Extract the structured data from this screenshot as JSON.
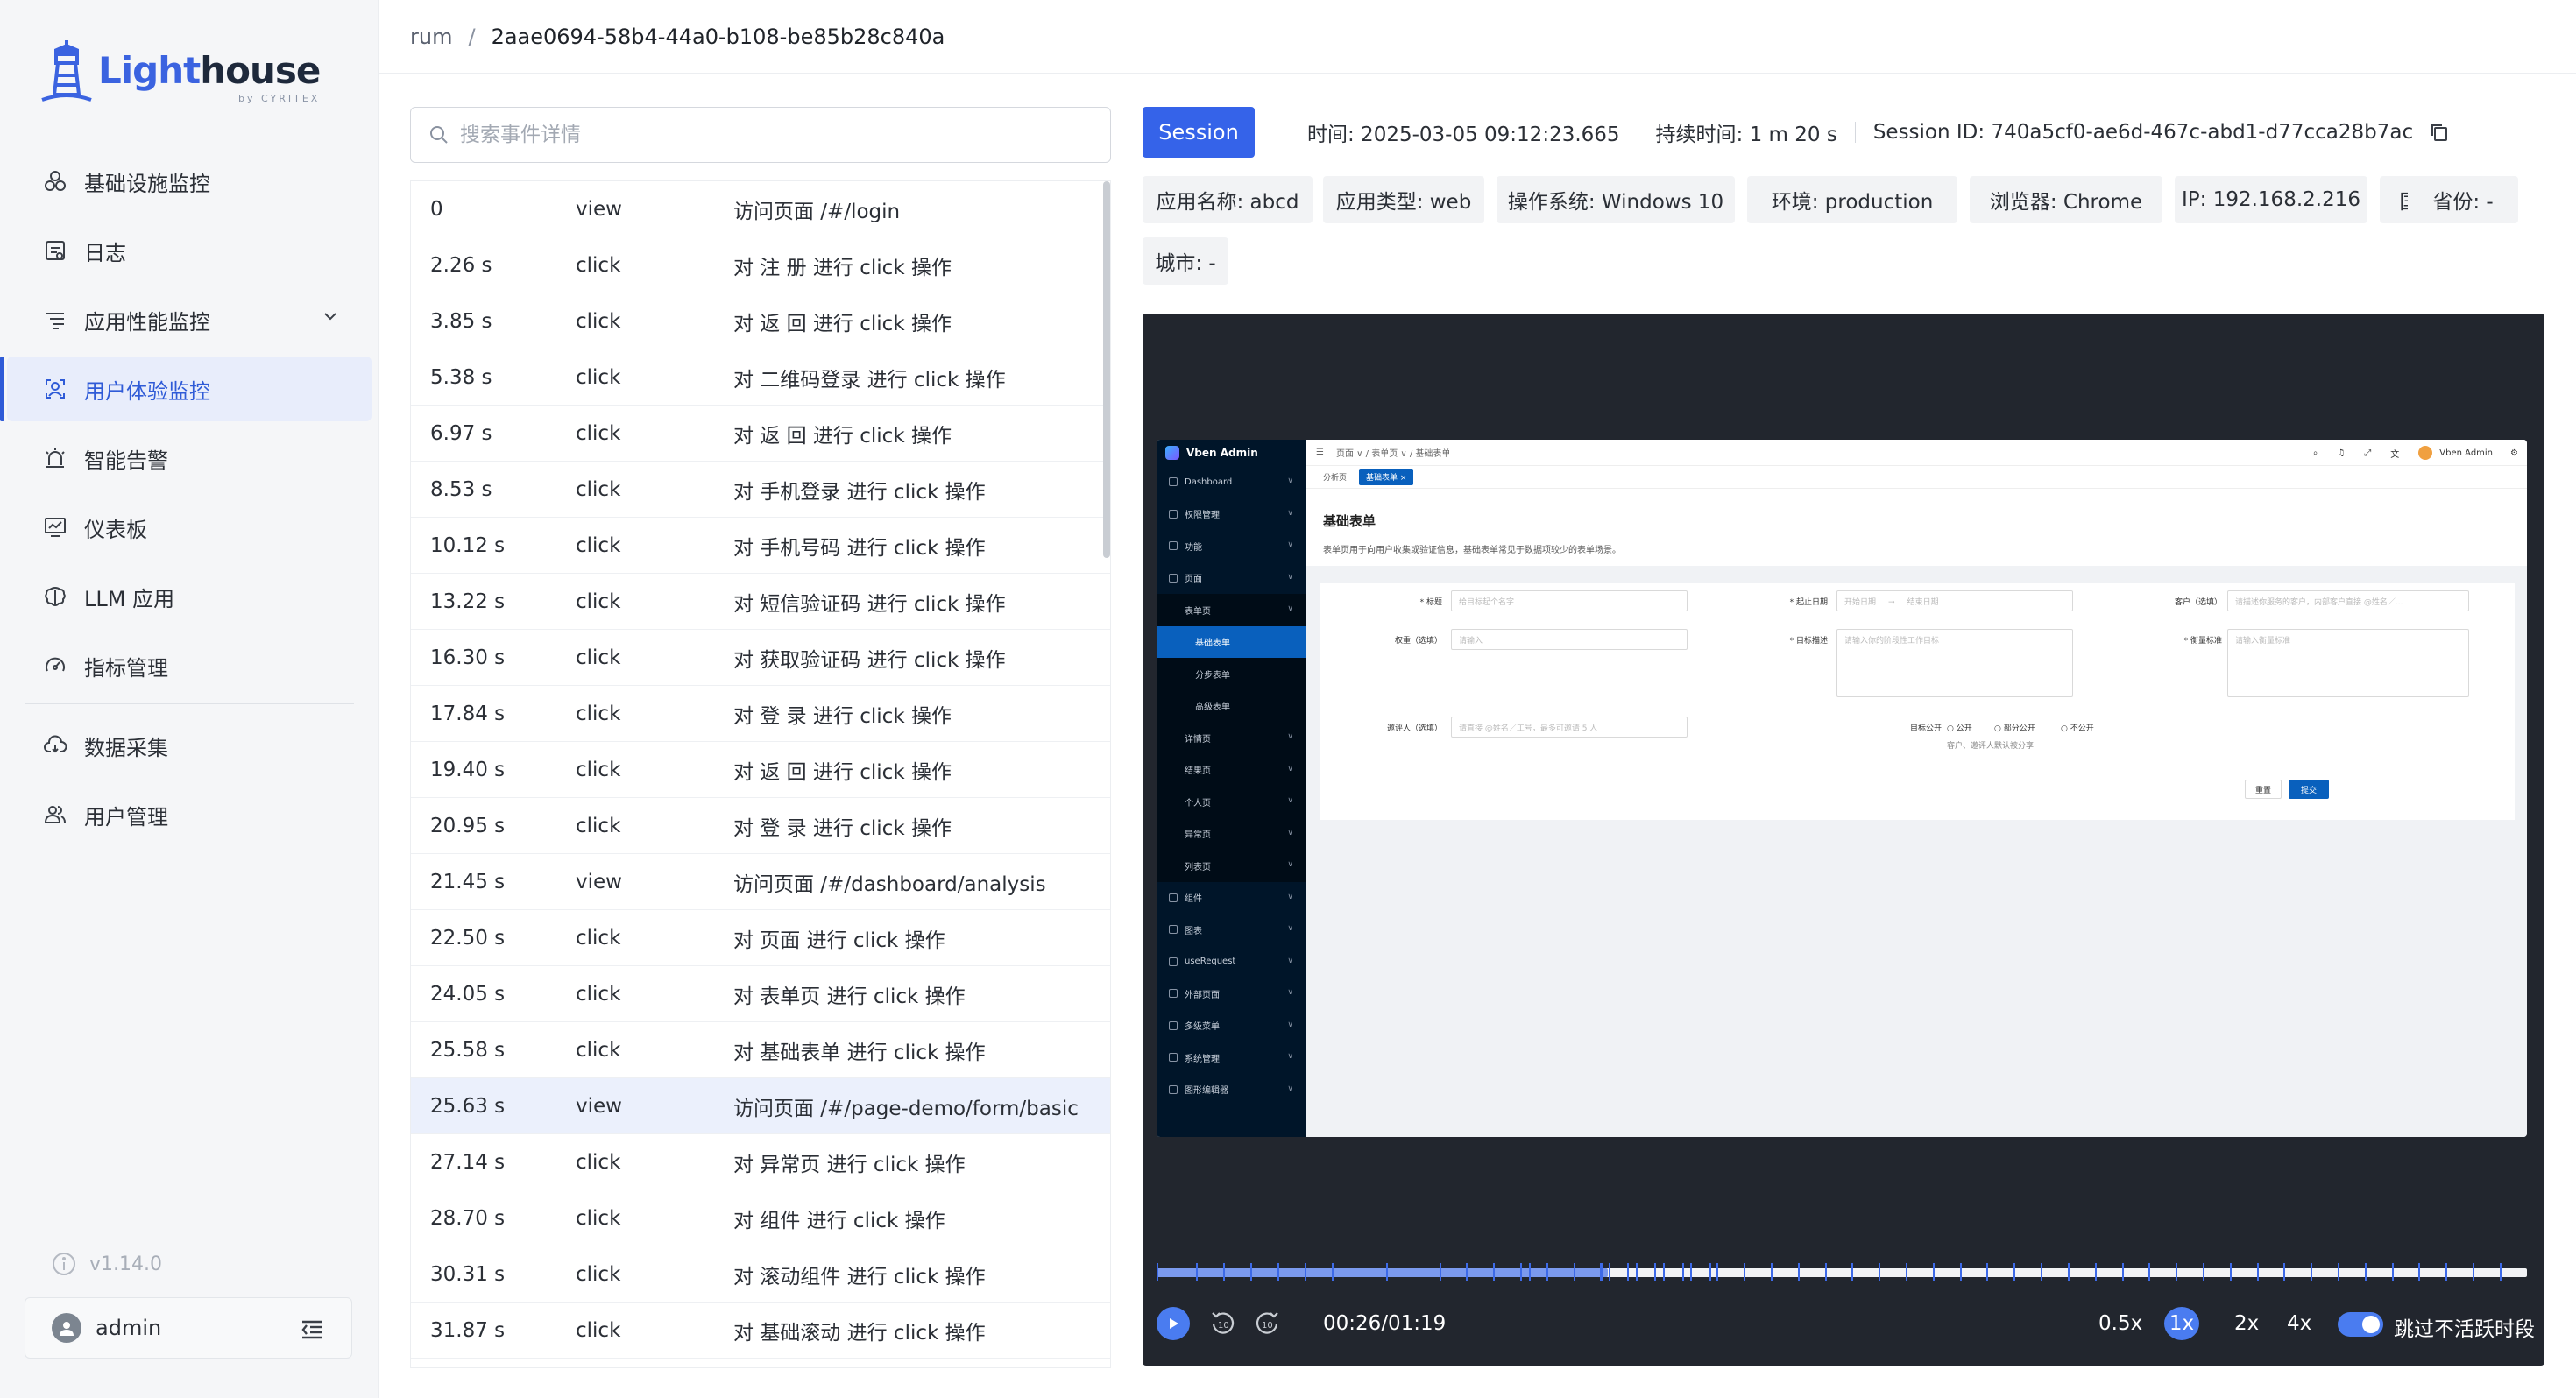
{
  "brand": {
    "name_light": "Light",
    "name_house": "house",
    "by": "by CYRITEX"
  },
  "sidebar": {
    "items": [
      {
        "label": "基础设施监控",
        "icon": "infrastructure-icon"
      },
      {
        "label": "日志",
        "icon": "log-icon"
      },
      {
        "label": "应用性能监控",
        "icon": "apm-icon"
      },
      {
        "label": "用户体验监控",
        "icon": "user-experience-icon"
      },
      {
        "label": "智能告警",
        "icon": "alarm-icon"
      },
      {
        "label": "仪表板",
        "icon": "dashboard-icon"
      },
      {
        "label": "LLM 应用",
        "icon": "llm-icon"
      },
      {
        "label": "指标管理",
        "icon": "metrics-icon"
      },
      {
        "label": "数据采集",
        "icon": "collect-icon"
      },
      {
        "label": "用户管理",
        "icon": "users-icon"
      }
    ],
    "version": "v1.14.0",
    "user": "admin"
  },
  "breadcrumb": {
    "root": "rum",
    "sep": "/",
    "current": "2aae0694-58b4-44a0-b108-be85b28c840a"
  },
  "search": {
    "placeholder": "搜索事件详情"
  },
  "events": [
    {
      "time": "0",
      "type": "view",
      "desc": "访问页面 /#/login"
    },
    {
      "time": "2.26 s",
      "type": "click",
      "desc": "对 注 册 进行 click 操作"
    },
    {
      "time": "3.85 s",
      "type": "click",
      "desc": "对 返 回 进行 click 操作"
    },
    {
      "time": "5.38 s",
      "type": "click",
      "desc": "对 二维码登录 进行 click 操作"
    },
    {
      "time": "6.97 s",
      "type": "click",
      "desc": "对 返 回 进行 click 操作"
    },
    {
      "time": "8.53 s",
      "type": "click",
      "desc": "对 手机登录 进行 click 操作"
    },
    {
      "time": "10.12 s",
      "type": "click",
      "desc": "对 手机号码 进行 click 操作"
    },
    {
      "time": "13.22 s",
      "type": "click",
      "desc": "对 短信验证码 进行 click 操作"
    },
    {
      "time": "16.30 s",
      "type": "click",
      "desc": "对 获取验证码 进行 click 操作"
    },
    {
      "time": "17.84 s",
      "type": "click",
      "desc": "对 登 录 进行 click 操作"
    },
    {
      "time": "19.40 s",
      "type": "click",
      "desc": "对 返 回 进行 click 操作"
    },
    {
      "time": "20.95 s",
      "type": "click",
      "desc": "对 登 录 进行 click 操作"
    },
    {
      "time": "21.45 s",
      "type": "view",
      "desc": "访问页面 /#/dashboard/analysis"
    },
    {
      "time": "22.50 s",
      "type": "click",
      "desc": "对 页面 进行 click 操作"
    },
    {
      "time": "24.05 s",
      "type": "click",
      "desc": "对 表单页 进行 click 操作"
    },
    {
      "time": "25.58 s",
      "type": "click",
      "desc": "对 基础表单 进行 click 操作"
    },
    {
      "time": "25.63 s",
      "type": "view",
      "desc": "访问页面 /#/page-demo/form/basic",
      "selected": true
    },
    {
      "time": "27.14 s",
      "type": "click",
      "desc": "对 异常页 进行 click 操作"
    },
    {
      "time": "28.70 s",
      "type": "click",
      "desc": "对 组件 进行 click 操作"
    },
    {
      "time": "30.31 s",
      "type": "click",
      "desc": "对 滚动组件 进行 click 操作"
    },
    {
      "time": "31.87 s",
      "type": "click",
      "desc": "对 基础滚动 进行 click 操作"
    }
  ],
  "session": {
    "button": "Session",
    "time": "时间: 2025-03-05 09:12:23.665",
    "duration": "持续时间: 1 m 20 s",
    "session_id": "Session ID: 740a5cf0-ae6d-467c-abd1-d77cca28b7ac",
    "tags": [
      "应用名称: abcd",
      "应用类型: web",
      "操作系统: Windows 10",
      "环境: production",
      "浏览器: Chrome",
      "IP: 192.168.2.216",
      "国家: -",
      "省份: -",
      "城市: -"
    ]
  },
  "replay": {
    "app_name": "Vben Admin",
    "menu": [
      "Dashboard",
      "权限管理",
      "功能",
      "页面",
      "表单页",
      "基础表单",
      "分步表单",
      "高级表单",
      "详情页",
      "结果页",
      "个人页",
      "异常页",
      "列表页",
      "组件",
      "图表",
      "useRequest",
      "外部页面",
      "多级菜单",
      "系统管理",
      "图形编辑器"
    ],
    "topbar_breadcrumb": "页面 ∨  /  表单页 ∨  /  基础表单",
    "user": "Vben Admin",
    "tabs": [
      "分析页",
      "基础表单 ×"
    ],
    "title": "基础表单",
    "description": "表单页用于向用户收集或验证信息，基础表单常见于数据项较少的表单场景。",
    "form": {
      "title_label": "* 标题",
      "title_ph": "给目标起个名字",
      "date_label": "* 起止日期",
      "date_start_ph": "开始日期",
      "date_end_ph": "结束日期",
      "client_label": "客户（选填）",
      "client_ph": "请描述你服务的客户，内部客户直接 @姓名／...",
      "weight_label": "权重（选填）",
      "weight_ph": "请输入",
      "goal_label": "* 目标描述",
      "goal_ph": "请输入你的阶段性工作目标",
      "standard_label": "* 衡量标准",
      "standard_ph": "请输入衡量标准",
      "invite_label": "邀评人（选填）",
      "invite_ph": "请直接 @姓名／工号，最多可邀请 5 人",
      "public_label": "目标公开",
      "opt_public": "公开",
      "opt_partial": "部分公开",
      "opt_private": "不公开",
      "public_hint": "客户、邀评人默认被分享",
      "reset": "重置",
      "submit": "提交"
    }
  },
  "player": {
    "time": "00:26/01:19",
    "progress": 0.329,
    "speeds": [
      "0.5x",
      "1x",
      "2x",
      "4x"
    ],
    "active_speed": "1x",
    "skip_inactive_label": "跳过不活跃时段",
    "skip_inactive": true,
    "accent": "#3563e9"
  }
}
